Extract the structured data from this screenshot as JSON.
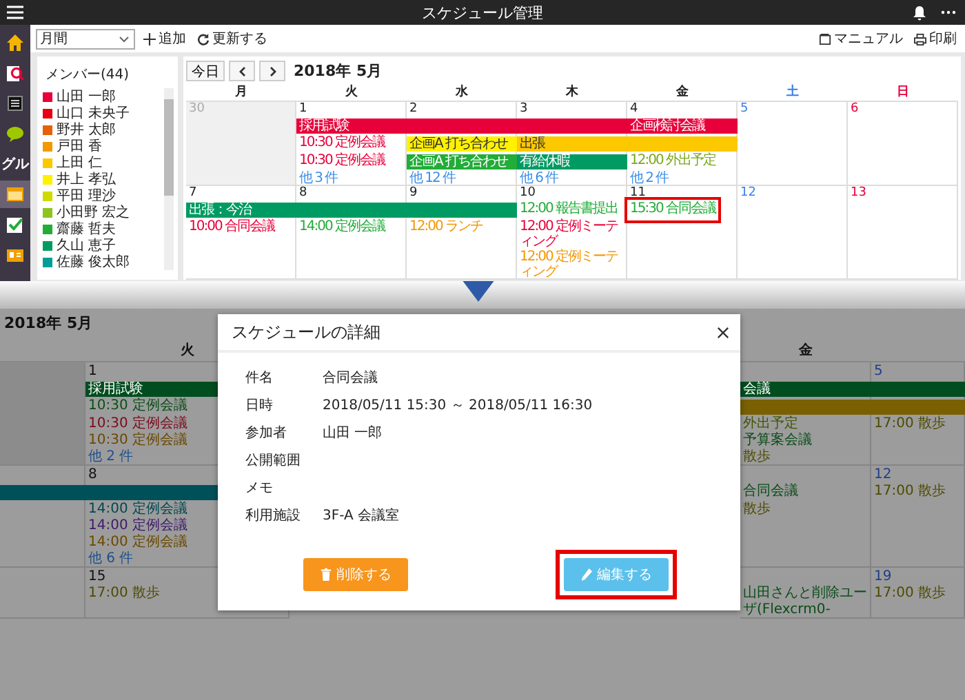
{
  "app_bar": {
    "title": "スケジュール管理"
  },
  "rail": {
    "items": [
      {
        "kind": "home",
        "selected": false
      },
      {
        "kind": "search",
        "selected": false
      },
      {
        "kind": "news",
        "selected": false
      },
      {
        "kind": "chat",
        "selected": false
      },
      {
        "kind": "text",
        "label": "グル",
        "selected": false
      },
      {
        "kind": "calendar",
        "selected": true
      },
      {
        "kind": "todo",
        "selected": false
      },
      {
        "kind": "card",
        "selected": false
      }
    ]
  },
  "toolbar": {
    "view_select": {
      "value": "月間"
    },
    "add_button": "追加",
    "refresh_button": "更新する",
    "manual_link": "マニュアル",
    "print_link": "印刷"
  },
  "members": {
    "heading": "メンバー(44)",
    "items": [
      {
        "name": "山田 一郎",
        "color": "#e8003a"
      },
      {
        "name": "山口 未央子",
        "color": "#e60012"
      },
      {
        "name": "野井 太郎",
        "color": "#e8600a"
      },
      {
        "name": "戸田 香",
        "color": "#f39800"
      },
      {
        "name": "上田 仁",
        "color": "#fcc800"
      },
      {
        "name": "井上 孝弘",
        "color": "#fff100"
      },
      {
        "name": "平田 理沙",
        "color": "#cfdb00"
      },
      {
        "name": "小田野 宏之",
        "color": "#8fc31f"
      },
      {
        "name": "齋藤 哲夫",
        "color": "#22ac38"
      },
      {
        "name": "久山 恵子",
        "color": "#009b63"
      },
      {
        "name": "佐藤 俊太郎",
        "color": "#009e96"
      }
    ]
  },
  "calendar": {
    "today_button": "今日",
    "month": "2018年 5月",
    "weekdays": [
      {
        "label": "月",
        "kind": "weekday"
      },
      {
        "label": "火",
        "kind": "weekday"
      },
      {
        "label": "水",
        "kind": "weekday"
      },
      {
        "label": "木",
        "kind": "weekday"
      },
      {
        "label": "金",
        "kind": "weekday"
      },
      {
        "label": "土",
        "kind": "saturday"
      },
      {
        "label": "日",
        "kind": "sunday"
      }
    ],
    "weeks": [
      {
        "days": [
          {
            "date": "30",
            "kind": "outside"
          },
          {
            "date": "1",
            "kind": "weekday",
            "entries": [
              {
                "kind": "bar",
                "label": "採用試験",
                "color": "#e8003a"
              },
              {
                "kind": "text",
                "label": "10:30 定例会議",
                "color": "#e8003a"
              },
              {
                "kind": "text",
                "label": "10:30 定例会議",
                "color": "#e8003a"
              },
              {
                "kind": "more",
                "label": "他 3 件"
              }
            ]
          },
          {
            "date": "2",
            "kind": "weekday",
            "entries": [
              {
                "kind": "bar",
                "color": "#e8003a"
              },
              {
                "kind": "bar",
                "label": "企画A 打ち合わせ",
                "color": "#fff100"
              },
              {
                "kind": "bar",
                "label": "企画A 打ち合わせ",
                "color": "#22ac38"
              },
              {
                "kind": "more",
                "label": "他 12 件"
              }
            ]
          },
          {
            "date": "3",
            "kind": "weekday",
            "entries": [
              {
                "kind": "bar",
                "color": "#e8003a"
              },
              {
                "kind": "bar",
                "label": "出張",
                "color": "#fcc800"
              },
              {
                "kind": "bar",
                "label": "有給休暇",
                "color": "#009b63"
              },
              {
                "kind": "more",
                "label": "他 6 件"
              }
            ]
          },
          {
            "date": "4",
            "kind": "weekday",
            "entries": [
              {
                "kind": "bar",
                "label": "企画検討会議",
                "color": "#e8003a"
              },
              {
                "kind": "bar",
                "color": "#fcc800"
              },
              {
                "kind": "text",
                "label": "12:00 外出予定",
                "color": "#7aa818"
              },
              {
                "kind": "more",
                "label": "他 2 件"
              }
            ]
          },
          {
            "date": "5",
            "kind": "saturday"
          },
          {
            "date": "6",
            "kind": "sunday"
          }
        ]
      },
      {
        "days": [
          {
            "date": "7",
            "kind": "weekday",
            "entries": [
              {
                "kind": "bar",
                "label": "出張：今治",
                "color": "#009b63"
              },
              {
                "kind": "text",
                "label": "10:00 合同会議",
                "color": "#e8003a"
              }
            ]
          },
          {
            "date": "8",
            "kind": "weekday",
            "entries": [
              {
                "kind": "bar",
                "color": "#009b63"
              },
              {
                "kind": "text",
                "label": "14:00 定例会議",
                "color": "#22ac38"
              }
            ]
          },
          {
            "date": "9",
            "kind": "weekday",
            "entries": [
              {
                "kind": "bar",
                "color": "#009b63"
              },
              {
                "kind": "text",
                "label": "12:00 ランチ",
                "color": "#f39800"
              }
            ]
          },
          {
            "date": "10",
            "kind": "weekday",
            "entries": [
              {
                "kind": "text",
                "label": "12:00 報告書提出",
                "color": "#22ac38"
              },
              {
                "kind": "text",
                "label": "12:00 定例ミーティング",
                "color": "#e8003a"
              },
              {
                "kind": "text",
                "label": "12:00 定例ミーティング",
                "color": "#f39800"
              }
            ]
          },
          {
            "date": "11",
            "kind": "weekday",
            "entries": [
              {
                "kind": "text",
                "label": "15:30 合同会議",
                "color": "#22ac38",
                "highlighted": true
              }
            ]
          },
          {
            "date": "12",
            "kind": "saturday"
          },
          {
            "date": "13",
            "kind": "sunday"
          }
        ]
      }
    ]
  },
  "detail_view": {
    "month": "2018年 5月",
    "headers": [
      "火",
      "金"
    ],
    "weeks": [
      {
        "days": [
          {
            "kind": "outside"
          },
          {
            "date": "1",
            "kind": "weekday",
            "entries": [
              {
                "kind": "bar",
                "label": "採用試験",
                "color": "#004d1f"
              },
              {
                "kind": "text",
                "label": "10:30 定例会議",
                "color": "#0a4d18"
              },
              {
                "kind": "text",
                "label": "10:30 定例会議",
                "color": "#7a0a1a"
              },
              {
                "kind": "text",
                "label": "10:30 定例会議",
                "color": "#6a4800"
              },
              {
                "kind": "more",
                "label": "他 2 件"
              }
            ]
          },
          {
            "kind": "weekday",
            "entries": [
              {
                "kind": "bar",
                "label": "会議",
                "color": "#004d1f"
              },
              {
                "kind": "bar",
                "color": "#7a6000"
              },
              {
                "kind": "text",
                "label": "外出予定",
                "color": "#3f5500"
              },
              {
                "kind": "text",
                "label": "予算案会議",
                "color": "#0a4d18"
              },
              {
                "kind": "text",
                "label": "散歩",
                "color": "#4c4a00"
              }
            ]
          },
          {
            "date": "5",
            "kind": "saturday",
            "entries": [
              {
                "kind": "bar",
                "color": "#004d1f"
              },
              {
                "kind": "bar",
                "color": "#7a6000"
              },
              {
                "kind": "text",
                "label": "17:00 散歩",
                "color": "#4c4a00"
              }
            ]
          }
        ]
      },
      {
        "days": [
          {
            "kind": "weekday",
            "entries": [
              {
                "kind": "bar",
                "color": "#00505a"
              }
            ]
          },
          {
            "date": "8",
            "kind": "weekday",
            "entries": [
              {
                "kind": "bar",
                "color": "#00505a"
              },
              {
                "kind": "text",
                "label": "14:00 定例会議",
                "color": "#00464e"
              },
              {
                "kind": "text",
                "label": "14:00 定例会議",
                "color": "#3d1a6b"
              },
              {
                "kind": "text",
                "label": "14:00 定例会議",
                "color": "#6a4800"
              },
              {
                "kind": "more",
                "label": "他 6 件"
              }
            ]
          },
          {
            "kind": "weekday",
            "entries": [
              {
                "kind": "text",
                "label": "合同会議",
                "color": "#0a4d18"
              },
              {
                "kind": "text",
                "label": "散歩",
                "color": "#4c4a00"
              }
            ]
          },
          {
            "date": "12",
            "kind": "saturday",
            "entries": [
              {
                "kind": "text",
                "label": "17:00 散歩",
                "color": "#4c4a00"
              }
            ]
          }
        ]
      },
      {
        "days": [
          {
            "kind": "weekday"
          },
          {
            "date": "15",
            "kind": "weekday",
            "entries": [
              {
                "kind": "text",
                "label": "17:00 散歩",
                "color": "#4c4a00"
              }
            ]
          },
          {
            "kind": "weekday",
            "entries": [
              {
                "kind": "text",
                "label": "山田さんと削除ユーザ(Flexcrm0-",
                "color": "#0a4d18"
              }
            ]
          },
          {
            "date": "19",
            "kind": "saturday",
            "entries": [
              {
                "kind": "text",
                "label": "17:00 散歩",
                "color": "#4c4a00"
              }
            ]
          }
        ]
      }
    ]
  },
  "modal": {
    "title": "スケジュールの詳細",
    "fields": [
      {
        "label": "件名",
        "value": "合同会議"
      },
      {
        "label": "日時",
        "value": "2018/05/11 15:30 ～ 2018/05/11 16:30"
      },
      {
        "label": "参加者",
        "value": "山田 一郎"
      },
      {
        "label": "公開範囲"
      },
      {
        "label": "メモ"
      },
      {
        "label": "利用施設",
        "value": "3F-A 会議室"
      }
    ],
    "buttons": [
      {
        "label": "削除する",
        "kind": "delete",
        "highlighted": false
      },
      {
        "label": "編集する",
        "kind": "edit",
        "highlighted": true
      }
    ]
  }
}
